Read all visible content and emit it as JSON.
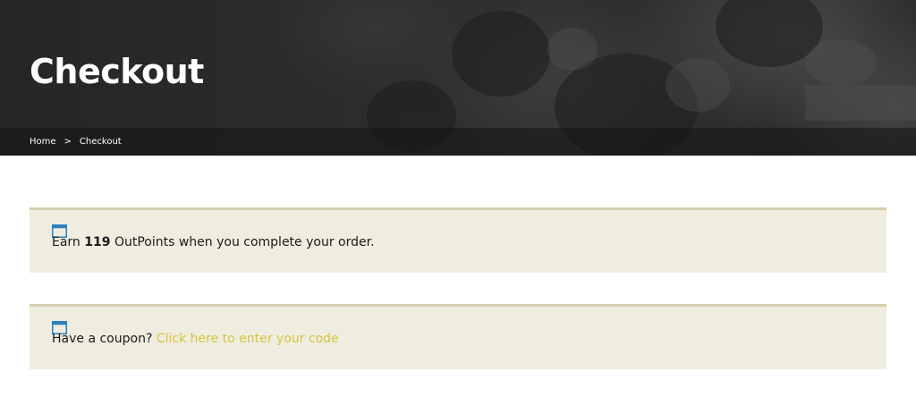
{
  "hero": {
    "title": "Checkout"
  },
  "breadcrumb": {
    "home": "Home",
    "separator": ">",
    "current": "Checkout"
  },
  "points_notice": {
    "icon": "window-icon",
    "prefix": "Earn ",
    "points": "119",
    "suffix": " OutPoints when you complete your order."
  },
  "coupon_notice": {
    "icon": "window-icon",
    "prompt": "Have a coupon? ",
    "link_text": "Click here to enter your code"
  },
  "colors": {
    "notice_bg": "#efede0",
    "notice_border": "#d5cfb0",
    "link": "#d7c33a",
    "icon_blue": "#2f7fc1"
  }
}
